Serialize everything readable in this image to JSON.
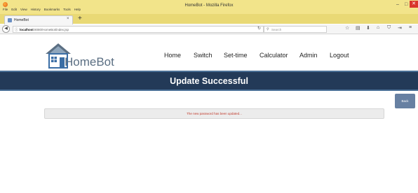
{
  "browser": {
    "window_title": "HomeBot - Mozilla Firefox",
    "menu": [
      "File",
      "Edit",
      "View",
      "History",
      "Bookmarks",
      "Tools",
      "Help"
    ],
    "tab_label": "HomeBot",
    "tab_close": "×",
    "new_tab": "+",
    "url_host": "localhost",
    "url_rest": ":8080/HomeBot/index.jsp",
    "search_placeholder": "Search",
    "controls": {
      "minimize": "–",
      "maximize": "□",
      "close": "✕"
    }
  },
  "site": {
    "logo_text": "HomeBot",
    "nav": [
      "Home",
      "Switch",
      "Set-time",
      "Calculator",
      "Admin",
      "Logout"
    ]
  },
  "page": {
    "banner_title": "Update Successful",
    "back_label": "Back",
    "message": "The new password has been updated..."
  },
  "colors": {
    "banner_bg": "#233a58",
    "banner_border": "#4a6f96",
    "back_button": "#6780a2",
    "message_text": "#c0392b",
    "titlebar": "#f2e48a"
  }
}
